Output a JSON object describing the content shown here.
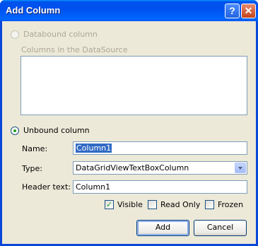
{
  "window": {
    "title": "Add Column"
  },
  "titlebar": {
    "help_glyph": "?",
    "close_glyph": "✕"
  },
  "databound": {
    "label": "Databound column",
    "columns_label": "Columns in the DataSource",
    "selected": false,
    "enabled": false
  },
  "unbound": {
    "label": "Unbound column",
    "selected": true
  },
  "fields": {
    "name_label": "Name:",
    "name_value": "Column1",
    "type_label": "Type:",
    "type_value": "DataGridViewTextBoxColumn",
    "header_label": "Header text:",
    "header_value": "Column1"
  },
  "options": [
    {
      "label": "Visible",
      "checked": true
    },
    {
      "label": "Read Only",
      "checked": false
    },
    {
      "label": "Frozen",
      "checked": false
    }
  ],
  "buttons": {
    "add": "Add",
    "cancel": "Cancel"
  },
  "colors": {
    "title_bar": "#0058ee",
    "dialog_bg": "#ece9d8",
    "selection": "#316ac5"
  }
}
